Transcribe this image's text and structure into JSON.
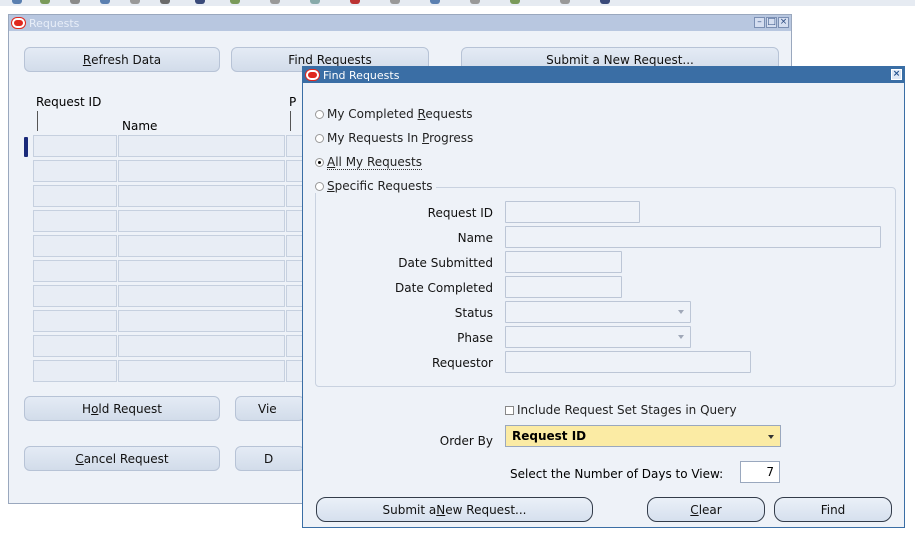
{
  "requests_window": {
    "title": "Requests",
    "buttons": {
      "refresh_pre": "",
      "refresh_ul": "R",
      "refresh_post": "efresh Data",
      "find_label": "Find Requests",
      "submit_label": "Submit a New Request...",
      "hold_pre": "H",
      "hold_ul": "o",
      "hold_post": "ld Request",
      "view_label": "Vie",
      "cancel_pre": "",
      "cancel_ul": "C",
      "cancel_post": "ancel Request",
      "d_label": "D"
    },
    "grid": {
      "col_request_id": "Request ID",
      "col_name": "Name",
      "col_p": "P",
      "row_count": 10
    }
  },
  "find_window": {
    "title": "Find Requests",
    "radios": {
      "completed_pre": "My Completed ",
      "completed_ul": "R",
      "completed_post": "equests",
      "progress_pre": "My Requests In ",
      "progress_ul": "P",
      "progress_post": "rogress",
      "all_pre": "",
      "all_ul": "A",
      "all_post": "ll My Requests",
      "specific_pre": "",
      "specific_ul": "S",
      "specific_post": "pecific Requests",
      "selected": "all"
    },
    "fields": {
      "request_id_label": "Request ID",
      "name_label": "Name",
      "date_submitted_label": "Date Submitted",
      "date_completed_label": "Date Completed",
      "status_label": "Status",
      "phase_label": "Phase",
      "requestor_label": "Requestor"
    },
    "include_stages_label": "Include Request Set Stages in Query",
    "order_by_label": "Order By",
    "order_by_value": "Request ID",
    "days_label": "Select the Number of Days to View:",
    "days_value": "7",
    "buttons": {
      "submit_pre": "Submit a ",
      "submit_ul": "N",
      "submit_post": "ew Request...",
      "clear_pre": "",
      "clear_ul": "C",
      "clear_post": "lear",
      "find_label": "Find"
    }
  },
  "colors": {
    "active_title": "#3a6ea5",
    "inactive_title": "#b8c7e0",
    "order_by_bg": "#fbeba4",
    "oracle_logo": "#e0281e"
  }
}
